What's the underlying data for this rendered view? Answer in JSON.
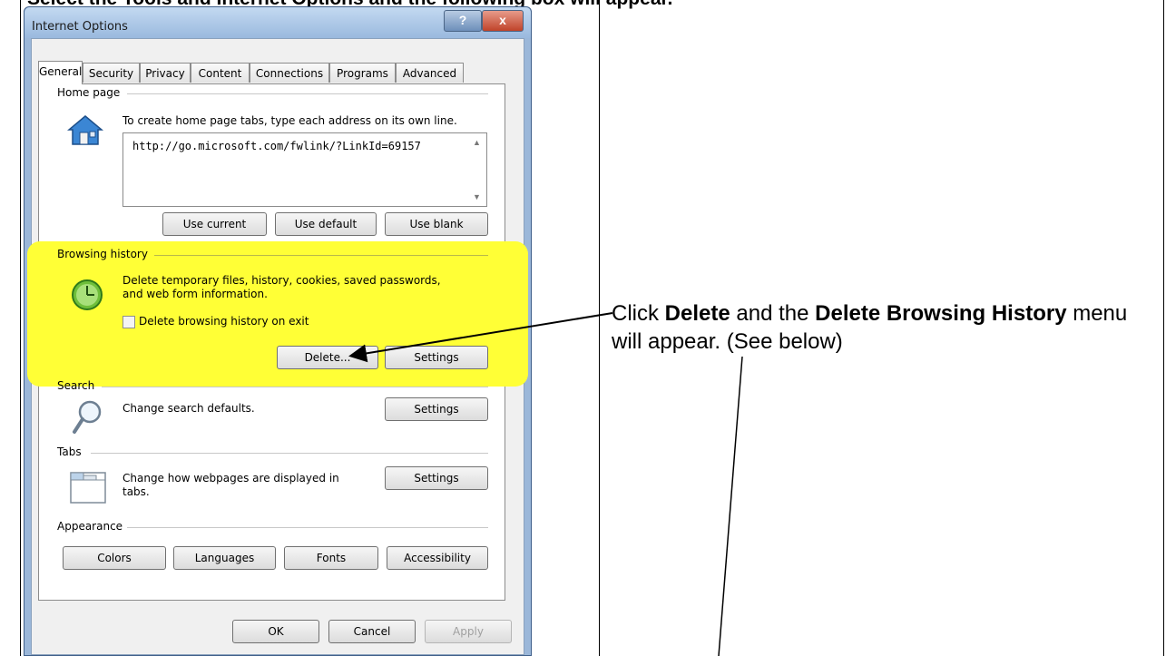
{
  "document": {
    "top_caption": "Select the Tools and Internet Options and the following box will appear."
  },
  "dialog": {
    "title": "Internet Options",
    "help_button": "?",
    "close_button": "x",
    "tabs": [
      {
        "label": "General",
        "active": true
      },
      {
        "label": "Security"
      },
      {
        "label": "Privacy"
      },
      {
        "label": "Content"
      },
      {
        "label": "Connections"
      },
      {
        "label": "Programs"
      },
      {
        "label": "Advanced"
      }
    ],
    "home_page": {
      "group_label": "Home page",
      "instruction": "To create home page tabs, type each address on its own line.",
      "url_value": "http://go.microsoft.com/fwlink/?LinkId=69157",
      "buttons": [
        "Use current",
        "Use default",
        "Use blank"
      ]
    },
    "browsing_history": {
      "group_label": "Browsing history",
      "description_line1": "Delete temporary files, history, cookies, saved passwords,",
      "description_line2": "and web form information.",
      "checkbox_label": "Delete browsing history on exit",
      "checkbox_checked": false,
      "delete_button": "Delete...",
      "settings_button": "Settings",
      "highlight_color": "#ffff36"
    },
    "search": {
      "group_label": "Search",
      "description": "Change search defaults.",
      "settings_button": "Settings"
    },
    "tabs_section": {
      "group_label": "Tabs",
      "description_line1": "Change how webpages are displayed in",
      "description_line2": "tabs.",
      "settings_button": "Settings"
    },
    "appearance": {
      "group_label": "Appearance",
      "buttons": [
        "Colors",
        "Languages",
        "Fonts",
        "Accessibility"
      ]
    },
    "footer": {
      "ok": "OK",
      "cancel": "Cancel",
      "apply": "Apply",
      "apply_enabled": false
    }
  },
  "annotation": {
    "part1": "Click ",
    "bold1": "Delete",
    "part2": " and the ",
    "bold2": "Delete Browsing History",
    "part3": " menu will appear.  (See below)"
  }
}
